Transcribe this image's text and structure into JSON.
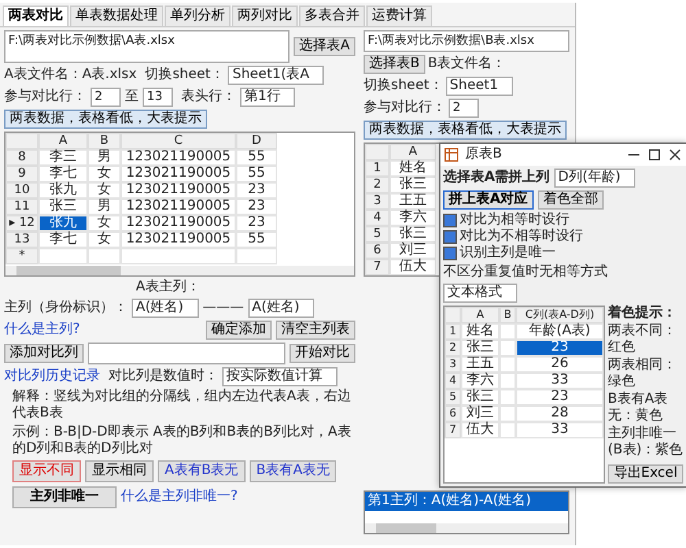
{
  "tabs": [
    {
      "label": "两表对比",
      "selected": true
    },
    {
      "label": "单表数据处理",
      "selected": false
    },
    {
      "label": "单列分析",
      "selected": false
    },
    {
      "label": "两列对比",
      "selected": false
    },
    {
      "label": "多表合并",
      "selected": false
    },
    {
      "label": "运费计算",
      "selected": false
    }
  ],
  "left": {
    "path": "F:\\两表对比示例数据\\A表.xlsx",
    "choose_button": "选择表A",
    "file_label": "A表文件名：A表.xlsx",
    "sheet_label": "切换sheet：",
    "sheet_value": "Sheet1(表A",
    "range_label": "参与对比行：",
    "range_from": "2",
    "range_to_label": "至",
    "range_to": "13",
    "header_label": "表头行：",
    "header_value": "第1行",
    "info_button": "两表数据，表格看低，大表提示",
    "grid": {
      "columns": [
        "A",
        "B",
        "C",
        "D"
      ],
      "rows": [
        {
          "header": "8",
          "cells": [
            {
              "text": "李三",
              "selected": false
            },
            {
              "text": "男",
              "selected": false
            },
            {
              "text": "123021190005",
              "selected": false
            },
            {
              "text": "55",
              "selected": false
            }
          ]
        },
        {
          "header": "9",
          "cells": [
            {
              "text": "李七",
              "selected": false
            },
            {
              "text": "女",
              "selected": false
            },
            {
              "text": "123021190005",
              "selected": false
            },
            {
              "text": "55",
              "selected": false
            }
          ]
        },
        {
          "header": "10",
          "cells": [
            {
              "text": "张九",
              "selected": false
            },
            {
              "text": "女",
              "selected": false
            },
            {
              "text": "123021190005",
              "selected": false
            },
            {
              "text": "23",
              "selected": false
            }
          ]
        },
        {
          "header": "11",
          "cells": [
            {
              "text": "张三",
              "selected": false
            },
            {
              "text": "男",
              "selected": false
            },
            {
              "text": "123021190005",
              "selected": false
            },
            {
              "text": "23",
              "selected": false
            }
          ]
        },
        {
          "header": "▸ 12",
          "cells": [
            {
              "text": "张九",
              "selected": true
            },
            {
              "text": "女",
              "selected": false
            },
            {
              "text": "123021190005",
              "selected": false
            },
            {
              "text": "23",
              "selected": false
            }
          ]
        },
        {
          "header": "13",
          "cells": [
            {
              "text": "李七",
              "selected": false
            },
            {
              "text": "女",
              "selected": false
            },
            {
              "text": "123021190005",
              "selected": false
            },
            {
              "text": "55",
              "selected": false
            }
          ]
        },
        {
          "header": "*",
          "cells": []
        }
      ]
    }
  },
  "right": {
    "path": "F:\\两表对比示例数据\\B表.xlsx",
    "choose_button": "选择表B",
    "file_label": "B表文件名：",
    "sheet_label": "切换sheet：",
    "sheet_value": "Sheet1",
    "range_label": "参与对比行：",
    "range_from": "2",
    "info_button": "两表数据，表格看低，大表提示",
    "grid": {
      "columns": [
        "A"
      ],
      "rows": [
        {
          "header": "1",
          "cells": [
            {
              "text": "姓名",
              "selected": false
            }
          ]
        },
        {
          "header": "2",
          "cells": [
            {
              "text": "张三",
              "selected": false
            }
          ]
        },
        {
          "header": "3",
          "cells": [
            {
              "text": "王五",
              "selected": false
            }
          ]
        },
        {
          "header": "4",
          "cells": [
            {
              "text": "李六",
              "selected": false
            }
          ]
        },
        {
          "header": "5",
          "cells": [
            {
              "text": "张三",
              "selected": false
            }
          ]
        },
        {
          "header": "6",
          "cells": [
            {
              "text": "刘三",
              "selected": false
            }
          ]
        },
        {
          "header": "7",
          "cells": [
            {
              "text": "伍大",
              "selected": false
            }
          ]
        }
      ]
    },
    "list": [
      {
        "text": "第1主列：A(姓名)-A(姓名)",
        "selected": true
      }
    ]
  },
  "main_column": {
    "caption": "A表主列：",
    "label": "主列（身份标识）：",
    "a_value": "A(姓名)",
    "separator": "———",
    "b_value": "A(姓名)",
    "add_button": "确定添加",
    "clear_button": "清空主列表",
    "help_link": "什么是主列?"
  },
  "compare": {
    "add_button": "添加对比列",
    "start_button": "开始对比",
    "history_link": "对比列历史记录",
    "numeric_label": "对比列是数值时：",
    "numeric_value": "按实际数值计算"
  },
  "notes": [
    "解释：竖线为对比组的分隔线，组内左边代表A表，右边代表B表",
    "示例：B-B|D-D即表示 A表的B列和B表的B列比对，A表的D列和B表的D列比对"
  ],
  "actions": [
    {
      "label": "显示不同",
      "kind": "red"
    },
    {
      "label": "显示相同",
      "kind": "plain"
    },
    {
      "label": "A表有B表无",
      "kind": "blue"
    },
    {
      "label": "B表有A表无",
      "kind": "blue"
    },
    {
      "label": "主列非唯一",
      "kind": "wide"
    }
  ],
  "non_unique_link": "什么是主列非唯一?",
  "dialog": {
    "title": "原表B",
    "pick_label": "选择表A需拼上列",
    "pick_value": "D列(年龄)",
    "join_button": "拼上表A对应",
    "color_button": "着色全部",
    "checks": [
      {
        "label": "对比为相等时设行",
        "checked": true
      },
      {
        "label": "对比为不相等时设行",
        "checked": true
      },
      {
        "label": "识别主列是唯一",
        "checked": true
      }
    ],
    "mode_label": "不区分重复值时无相等方式",
    "mode_value": "文本格式",
    "grid": {
      "columns": [
        "A",
        "B",
        "C列(表A-D列)"
      ],
      "rows": [
        {
          "header": "1",
          "cells": [
            {
              "text": "姓名",
              "selected": false
            },
            {
              "selected": false
            },
            {
              "text": "年龄(A表)",
              "selected": false
            }
          ]
        },
        {
          "header": "2",
          "cells": [
            {
              "text": "张三",
              "selected": false
            },
            {
              "selected": false
            },
            {
              "text": "23",
              "selected": true
            }
          ]
        },
        {
          "header": "3",
          "cells": [
            {
              "text": "王五",
              "selected": false
            },
            {
              "selected": false
            },
            {
              "text": "26",
              "selected": false
            }
          ]
        },
        {
          "header": "4",
          "cells": [
            {
              "text": "李六",
              "selected": false
            },
            {
              "selected": false
            },
            {
              "text": "33",
              "selected": false
            }
          ]
        },
        {
          "header": "5",
          "cells": [
            {
              "text": "张三",
              "selected": false
            },
            {
              "selected": false
            },
            {
              "text": "23",
              "selected": false
            }
          ]
        },
        {
          "header": "6",
          "cells": [
            {
              "text": "刘三",
              "selected": false
            },
            {
              "selected": false
            },
            {
              "text": "28",
              "selected": false
            }
          ]
        },
        {
          "header": "7",
          "cells": [
            {
              "text": "伍大",
              "selected": false
            },
            {
              "selected": false
            },
            {
              "text": "33",
              "selected": false
            }
          ]
        }
      ]
    },
    "hints_title": "着色提示：",
    "hints": [
      "两表不同：红色",
      "两表相同：绿色",
      "B表有A表无：黄色",
      "主列非唯一(B表)：紫色"
    ],
    "export_button": "导出Excel"
  }
}
